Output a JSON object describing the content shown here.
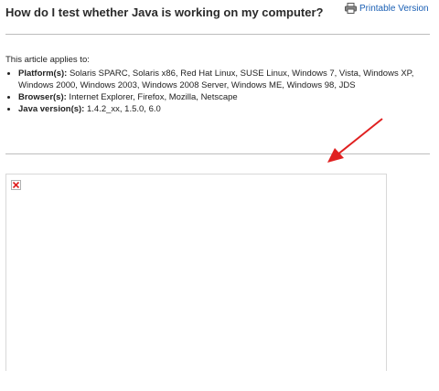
{
  "article": {
    "title": "How do I test whether Java is working on my computer?",
    "printable_label": "Printable Version",
    "applies_intro": "This article applies to:",
    "applies": [
      {
        "label": "Platform(s):",
        "value": " Solaris SPARC, Solaris x86, Red Hat Linux, SUSE Linux, Windows 7, Vista, Windows XP, Windows 2000, Windows 2003, Windows 2008 Server, Windows ME, Windows 98, JDS"
      },
      {
        "label": "Browser(s):",
        "value": " Internet Explorer, Firefox, Mozilla, Netscape"
      },
      {
        "label": "Java version(s):",
        "value": " 1.4.2_xx, 1.5.0, 6.0"
      }
    ]
  },
  "icons": {
    "printer": "printer-icon",
    "broken_image": "broken-image-icon",
    "annotation_arrow": "arrow-icon"
  },
  "colors": {
    "link": "#1a5fb4",
    "arrow": "#e02020",
    "broken_x": "#e02020",
    "rule": "#bdbdbd"
  }
}
